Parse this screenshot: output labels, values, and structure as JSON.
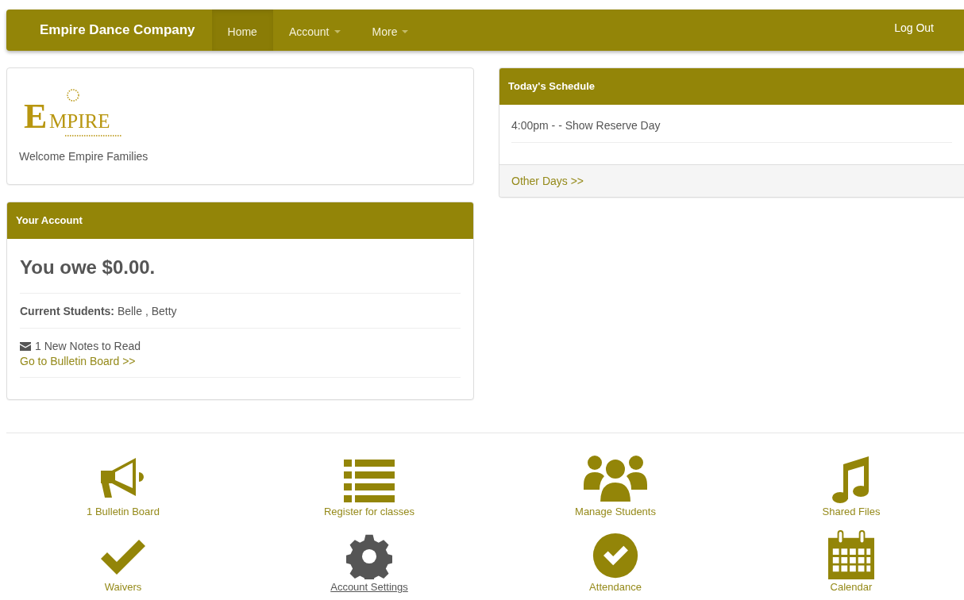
{
  "navbar": {
    "brand": "Empire Dance Company",
    "items": [
      {
        "label": "Home",
        "selected": true,
        "dropdown": false
      },
      {
        "label": "Account",
        "selected": false,
        "dropdown": true
      },
      {
        "label": "More",
        "selected": false,
        "dropdown": true
      }
    ],
    "logout": "Log Out"
  },
  "welcome_card": {
    "logo": {
      "initial": "E",
      "rest": "MPIRE"
    },
    "text": "Welcome Empire Families"
  },
  "account_card": {
    "title": "Your Account",
    "balance": "You owe $0.00.",
    "students": "**Current Students:** Belle , Betty",
    "notes": "1 New Notes to Read",
    "link": "Go to Bulletin Board >>"
  },
  "schedule_card": {
    "title": "Today's Schedule",
    "events": [
      "4:00pm - - Show Reserve Day"
    ],
    "footer_link": "Other Days >>"
  },
  "tiles": [
    {
      "kind": "megaphone",
      "label": "1 Bulletin Board",
      "hovered": false
    },
    {
      "kind": "list",
      "label": "Register for classes",
      "hovered": false
    },
    {
      "kind": "users",
      "label": "Manage Students",
      "hovered": false
    },
    {
      "kind": "music",
      "label": "Shared Files",
      "hovered": false
    },
    {
      "kind": "check",
      "label": "Waivers",
      "hovered": false
    },
    {
      "kind": "gear",
      "label": "Account Settings",
      "hovered": true
    },
    {
      "kind": "check-circle",
      "label": "Attendance",
      "hovered": false
    },
    {
      "kind": "calendar",
      "label": "Calendar",
      "hovered": false
    }
  ]
}
